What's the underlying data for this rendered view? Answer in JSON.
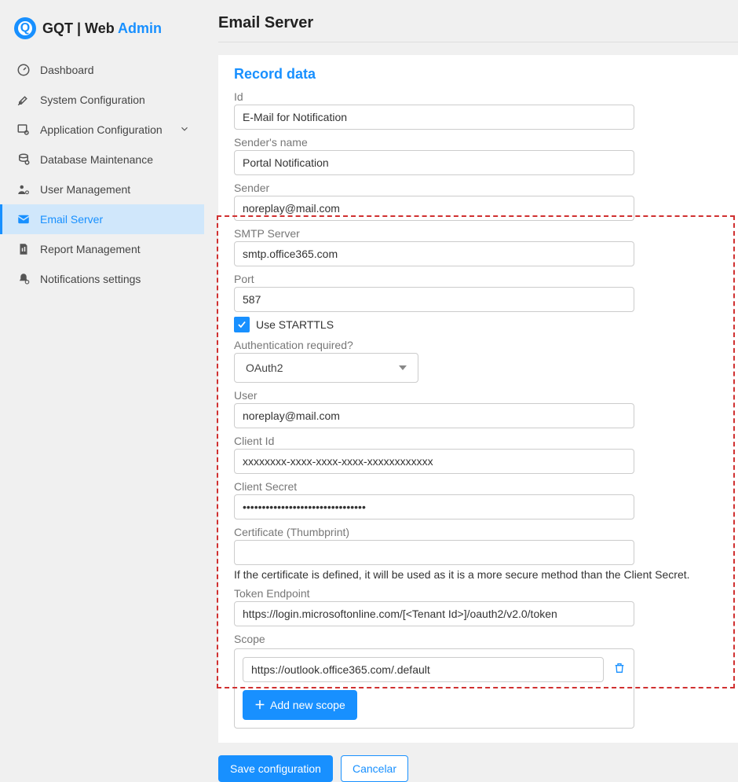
{
  "brand": {
    "logoLetter": "Q",
    "prefix": "GQT | Web ",
    "suffix": "Admin"
  },
  "sidebar": {
    "items": [
      {
        "label": "Dashboard"
      },
      {
        "label": "System Configuration"
      },
      {
        "label": "Application Configuration"
      },
      {
        "label": "Database Maintenance"
      },
      {
        "label": "User Management"
      },
      {
        "label": "Email Server"
      },
      {
        "label": "Report Management"
      },
      {
        "label": "Notifications settings"
      }
    ]
  },
  "page": {
    "title": "Email Server"
  },
  "form": {
    "sectionTitle": "Record data",
    "id_label": "Id",
    "id_value": "E-Mail for Notification",
    "senderName_label": "Sender's name",
    "senderName_value": "Portal Notification",
    "sender_label": "Sender",
    "sender_value": "noreplay@mail.com",
    "smtp_label": "SMTP Server",
    "smtp_value": "smtp.office365.com",
    "port_label": "Port",
    "port_value": "587",
    "starttls_label": "Use STARTTLS",
    "auth_label": "Authentication required?",
    "auth_value": "OAuth2",
    "user_label": "User",
    "user_value": "noreplay@mail.com",
    "clientId_label": "Client Id",
    "clientId_value": "xxxxxxxx-xxxx-xxxx-xxxx-xxxxxxxxxxxx",
    "clientSecret_label": "Client Secret",
    "clientSecret_value": "••••••••••••••••••••••••••••••••",
    "cert_label": "Certificate (Thumbprint)",
    "cert_value": "",
    "cert_hint": "If the certificate is defined, it will be used as it is a more secure method than the Client Secret.",
    "tokenEndpoint_label": "Token Endpoint",
    "tokenEndpoint_value": "https://login.microsoftonline.com/[<Tenant Id>]/oauth2/v2.0/token",
    "scope_label": "Scope",
    "scope_value": "https://outlook.office365.com/.default",
    "addScope_label": "Add new scope"
  },
  "actions": {
    "save": "Save configuration",
    "cancel": "Cancelar"
  }
}
